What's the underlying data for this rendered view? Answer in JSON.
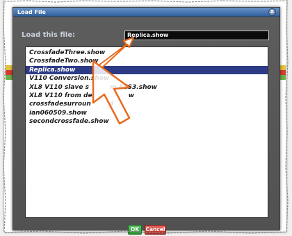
{
  "dialog": {
    "title": "Load File",
    "close_label": "X",
    "load_label": "Load this file:",
    "file_value": "Replica.show",
    "files": [
      "CrossfadeThree.show",
      "CrossfadeTwo.show",
      "Replica.show",
      "V110 Conversion.show",
      "XL8 V110  slave s",
      "XL8 V110 from de",
      "crossfadesurroun",
      "ian060509.show",
      "secondcrossfade.show"
    ],
    "file_tails": {
      "4": "m AES3.show",
      "5": "w",
      "6": "d"
    },
    "selected_index": 2,
    "ok_label": "OK",
    "cancel_label": "Cancel"
  },
  "colors": {
    "selection": "#2d3b86",
    "annotation": "#ea6a1e",
    "ok": "#25912c",
    "cancel": "#b2271e"
  }
}
